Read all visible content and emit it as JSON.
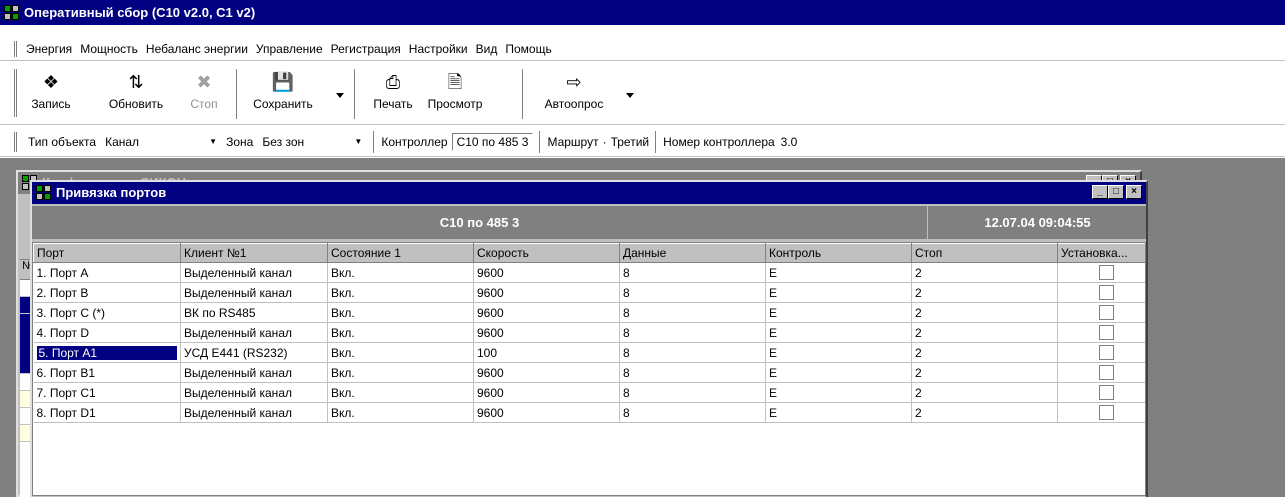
{
  "app": {
    "title": "Оперативный сбор (С10 v2.0, С1 v2)"
  },
  "menu": [
    {
      "label": "Энергия"
    },
    {
      "label": "Мощность"
    },
    {
      "label": "Небаланс энергии"
    },
    {
      "label": "Управление"
    },
    {
      "label": "Регистрация"
    },
    {
      "label": "Настройки"
    },
    {
      "label": "Вид"
    },
    {
      "label": "Помощь"
    }
  ],
  "toolbar": {
    "record": "Запись",
    "refresh": "Обновить",
    "stop": "Стоп",
    "save": "Сохранить",
    "print": "Печать",
    "preview": "Просмотр",
    "autopoll": "Автоопрос"
  },
  "infobar": {
    "object_type_label": "Тип объекта",
    "object_type_value": "Канал",
    "zone_label": "Зона",
    "zone_value": "Без зон",
    "controller_label": "Контроллер",
    "controller_value": "С10 по 485 3",
    "route_label": "Маршрут",
    "route_value": "Третий",
    "controller_number_label": "Номер контроллера",
    "controller_number_value": "3.0"
  },
  "config_window": {
    "title": "Конфигурация СИКОН",
    "col_header": "№"
  },
  "ports_window": {
    "title": "Привязка портов",
    "controller": "С10 по 485 3",
    "timestamp": "12.07.04 09:04:55",
    "columns": [
      "Порт",
      "Клиент №1",
      "Состояние 1",
      "Скорость",
      "Данные",
      "Контроль",
      "Стоп",
      "Установка..."
    ],
    "rows": [
      {
        "port": "1. Порт А",
        "client": "Выделенный канал",
        "state": "Вкл.",
        "speed": "9600",
        "data": "8",
        "control": "E",
        "stop": "2",
        "checked": false
      },
      {
        "port": "2. Порт В",
        "client": "Выделенный канал",
        "state": "Вкл.",
        "speed": "9600",
        "data": "8",
        "control": "E",
        "stop": "2",
        "checked": false
      },
      {
        "port": "3. Порт С (*)",
        "client": "ВК по RS485",
        "state": "Вкл.",
        "speed": "9600",
        "data": "8",
        "control": "E",
        "stop": "2",
        "checked": false
      },
      {
        "port": "4. Порт D",
        "client": "Выделенный канал",
        "state": "Вкл.",
        "speed": "9600",
        "data": "8",
        "control": "E",
        "stop": "2",
        "checked": false
      },
      {
        "port": "5. Порт А1",
        "client": "УСД Е441 (RS232)",
        "state": "Вкл.",
        "speed": "100",
        "data": "8",
        "control": "E",
        "stop": "2",
        "checked": false,
        "selected": true
      },
      {
        "port": "6. Порт В1",
        "client": "Выделенный канал",
        "state": "Вкл.",
        "speed": "9600",
        "data": "8",
        "control": "E",
        "stop": "2",
        "checked": false
      },
      {
        "port": "7. Порт С1",
        "client": "Выделенный канал",
        "state": "Вкл.",
        "speed": "9600",
        "data": "8",
        "control": "E",
        "stop": "2",
        "checked": false
      },
      {
        "port": "8. Порт D1",
        "client": "Выделенный канал",
        "state": "Вкл.",
        "speed": "9600",
        "data": "8",
        "control": "E",
        "stop": "2",
        "checked": false
      }
    ]
  }
}
